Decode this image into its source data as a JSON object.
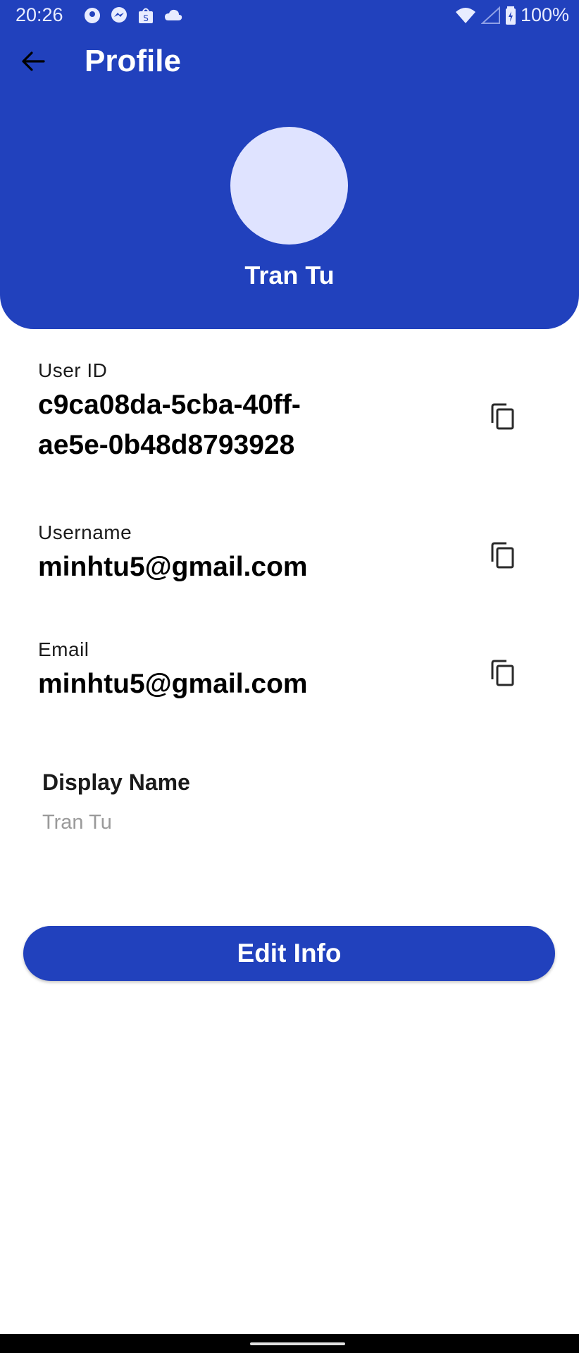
{
  "status_bar": {
    "time": "20:26",
    "battery_percent": "100%",
    "notification_icons": [
      "app-icon",
      "messenger-icon",
      "shopee-icon",
      "cloud-icon"
    ]
  },
  "app_bar": {
    "title": "Profile"
  },
  "profile": {
    "name": "Tran Tu"
  },
  "fields": {
    "user_id": {
      "label": "User ID",
      "value_line1": "c9ca08da-5cba-40ff-",
      "value_line2": "ae5e-0b48d8793928"
    },
    "username": {
      "label": "Username",
      "value": "minhtu5@gmail.com"
    },
    "email": {
      "label": "Email",
      "value": "minhtu5@gmail.com"
    }
  },
  "display_name": {
    "label": "Display Name",
    "placeholder": "Tran Tu"
  },
  "actions": {
    "edit_label": "Edit Info"
  },
  "colors": {
    "primary": "#2141BD",
    "avatar_bg": "#DFE3FF",
    "hint_text": "#9a9a9a"
  }
}
